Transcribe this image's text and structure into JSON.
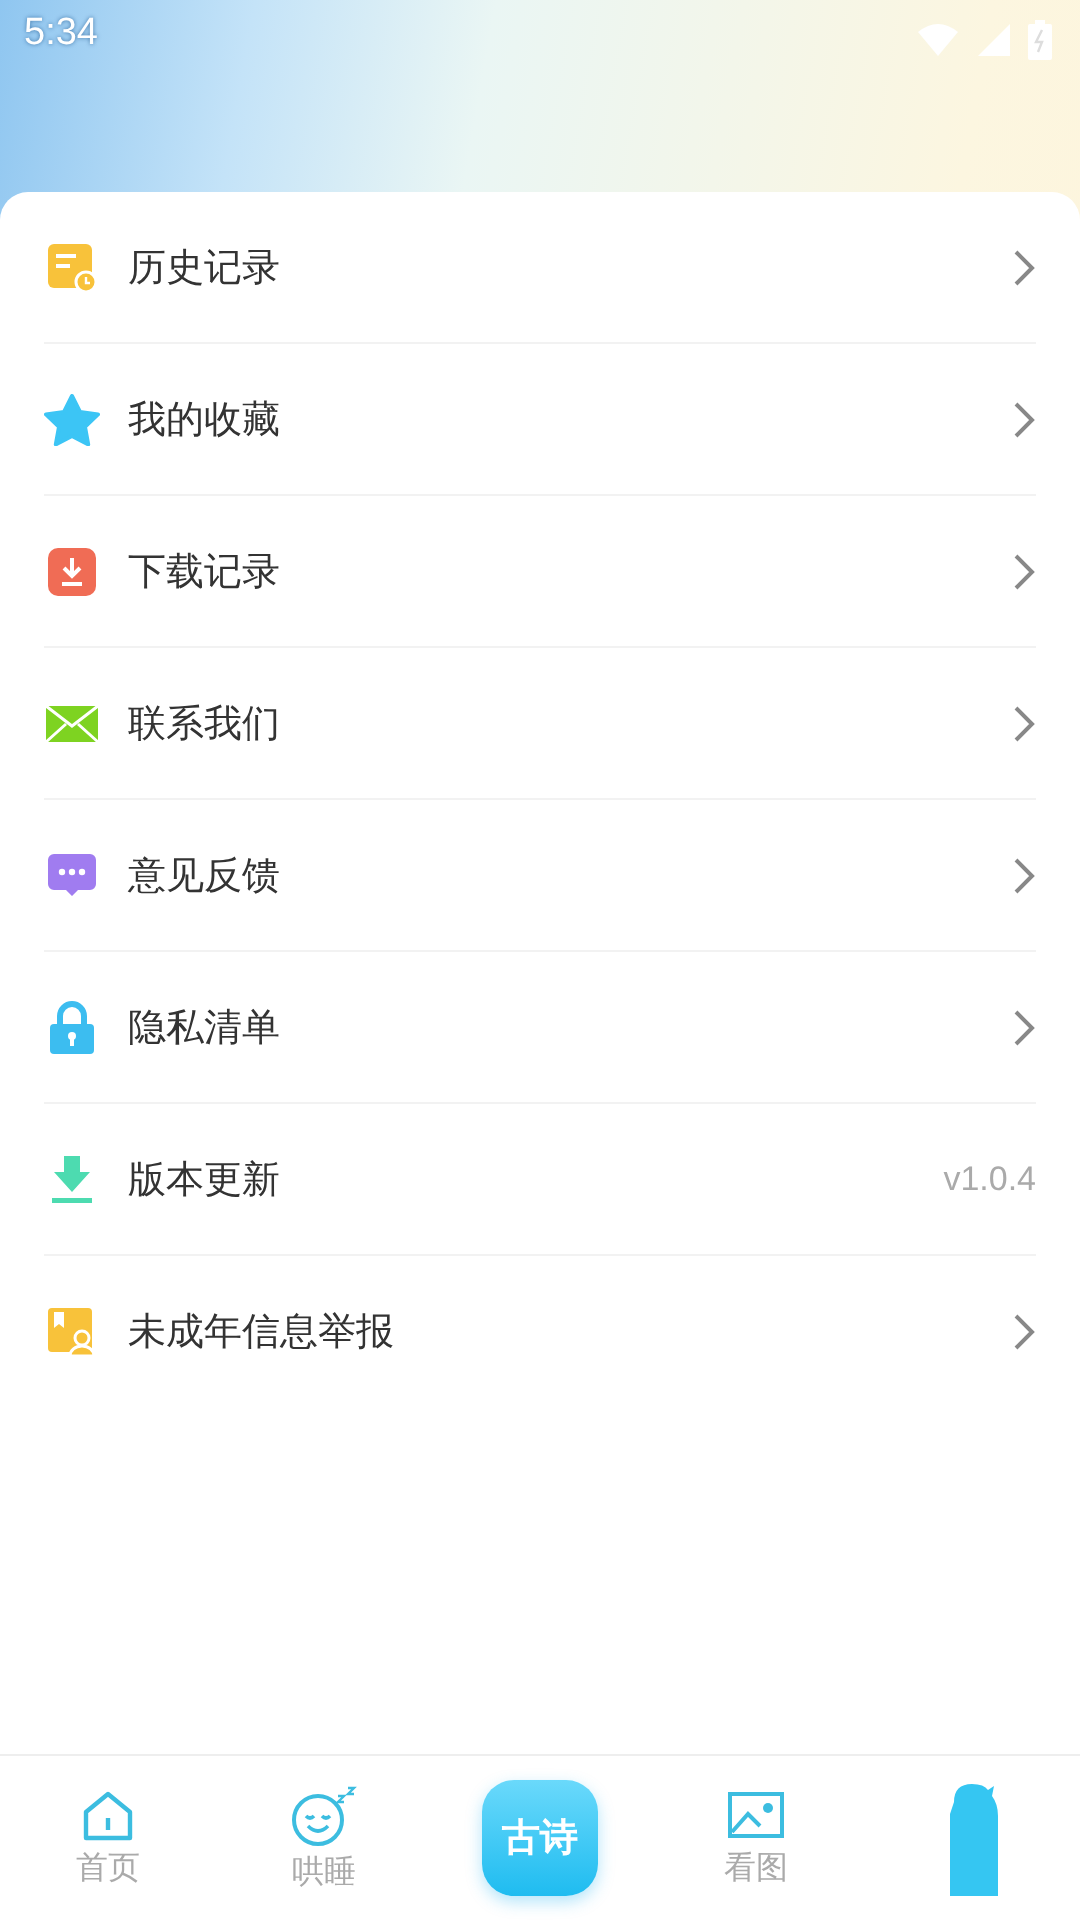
{
  "status_bar": {
    "time": "5:34"
  },
  "menu": [
    {
      "label": "历史记录",
      "kind": "arrow"
    },
    {
      "label": "我的收藏",
      "kind": "arrow"
    },
    {
      "label": "下载记录",
      "kind": "arrow"
    },
    {
      "label": "联系我们",
      "kind": "arrow"
    },
    {
      "label": "意见反馈",
      "kind": "arrow"
    },
    {
      "label": "隐私清单",
      "kind": "arrow"
    },
    {
      "label": "版本更新",
      "kind": "value",
      "value": "v1.0.4"
    },
    {
      "label": "未成年信息举报",
      "kind": "arrow"
    }
  ],
  "tabs": [
    {
      "label": "首页",
      "kind": "tab"
    },
    {
      "label": "哄睡",
      "kind": "tab"
    },
    {
      "label": "古诗",
      "kind": "center"
    },
    {
      "label": "看图",
      "kind": "tab"
    },
    {
      "kind": "tab"
    }
  ]
}
